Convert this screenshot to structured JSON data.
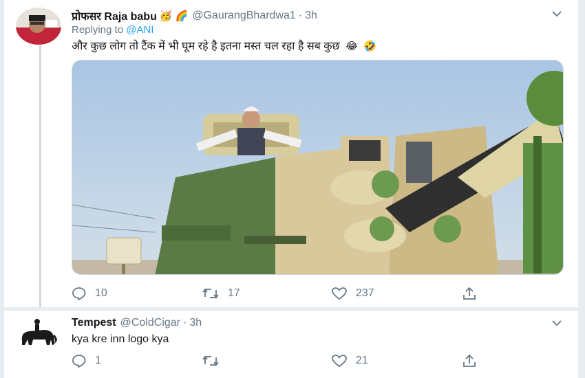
{
  "tweets": [
    {
      "display_name": "प्रोफसर Raja babu",
      "name_emojis": [
        "🥳",
        "🌈"
      ],
      "handle": "@GaurangBhardwa1",
      "separator": "·",
      "time": "3h",
      "replying_prefix": "Replying to",
      "replying_to": "@ANI",
      "text": "और कुछ लोग तो टैंक में भी घूम रहे है इतना मस्त चल रहा है सब कुछ",
      "text_emojis": [
        "😂",
        "🤣"
      ],
      "media_icon": "photo-tank",
      "replies": "10",
      "retweets": "17",
      "likes": "237"
    },
    {
      "display_name": "Tempest",
      "handle": "@ColdCigar",
      "separator": "·",
      "time": "3h",
      "text": "kya kre inn logo kya",
      "avatar_icon": "elephant-rider-silhouette",
      "replies": "1",
      "retweets": "",
      "likes": "21"
    }
  ],
  "colors": {
    "background": "#e6ecf0",
    "card": "#ffffff",
    "text": "#14171a",
    "secondary": "#657786",
    "link": "#1da1f2",
    "thread_line": "#cfd9de"
  }
}
